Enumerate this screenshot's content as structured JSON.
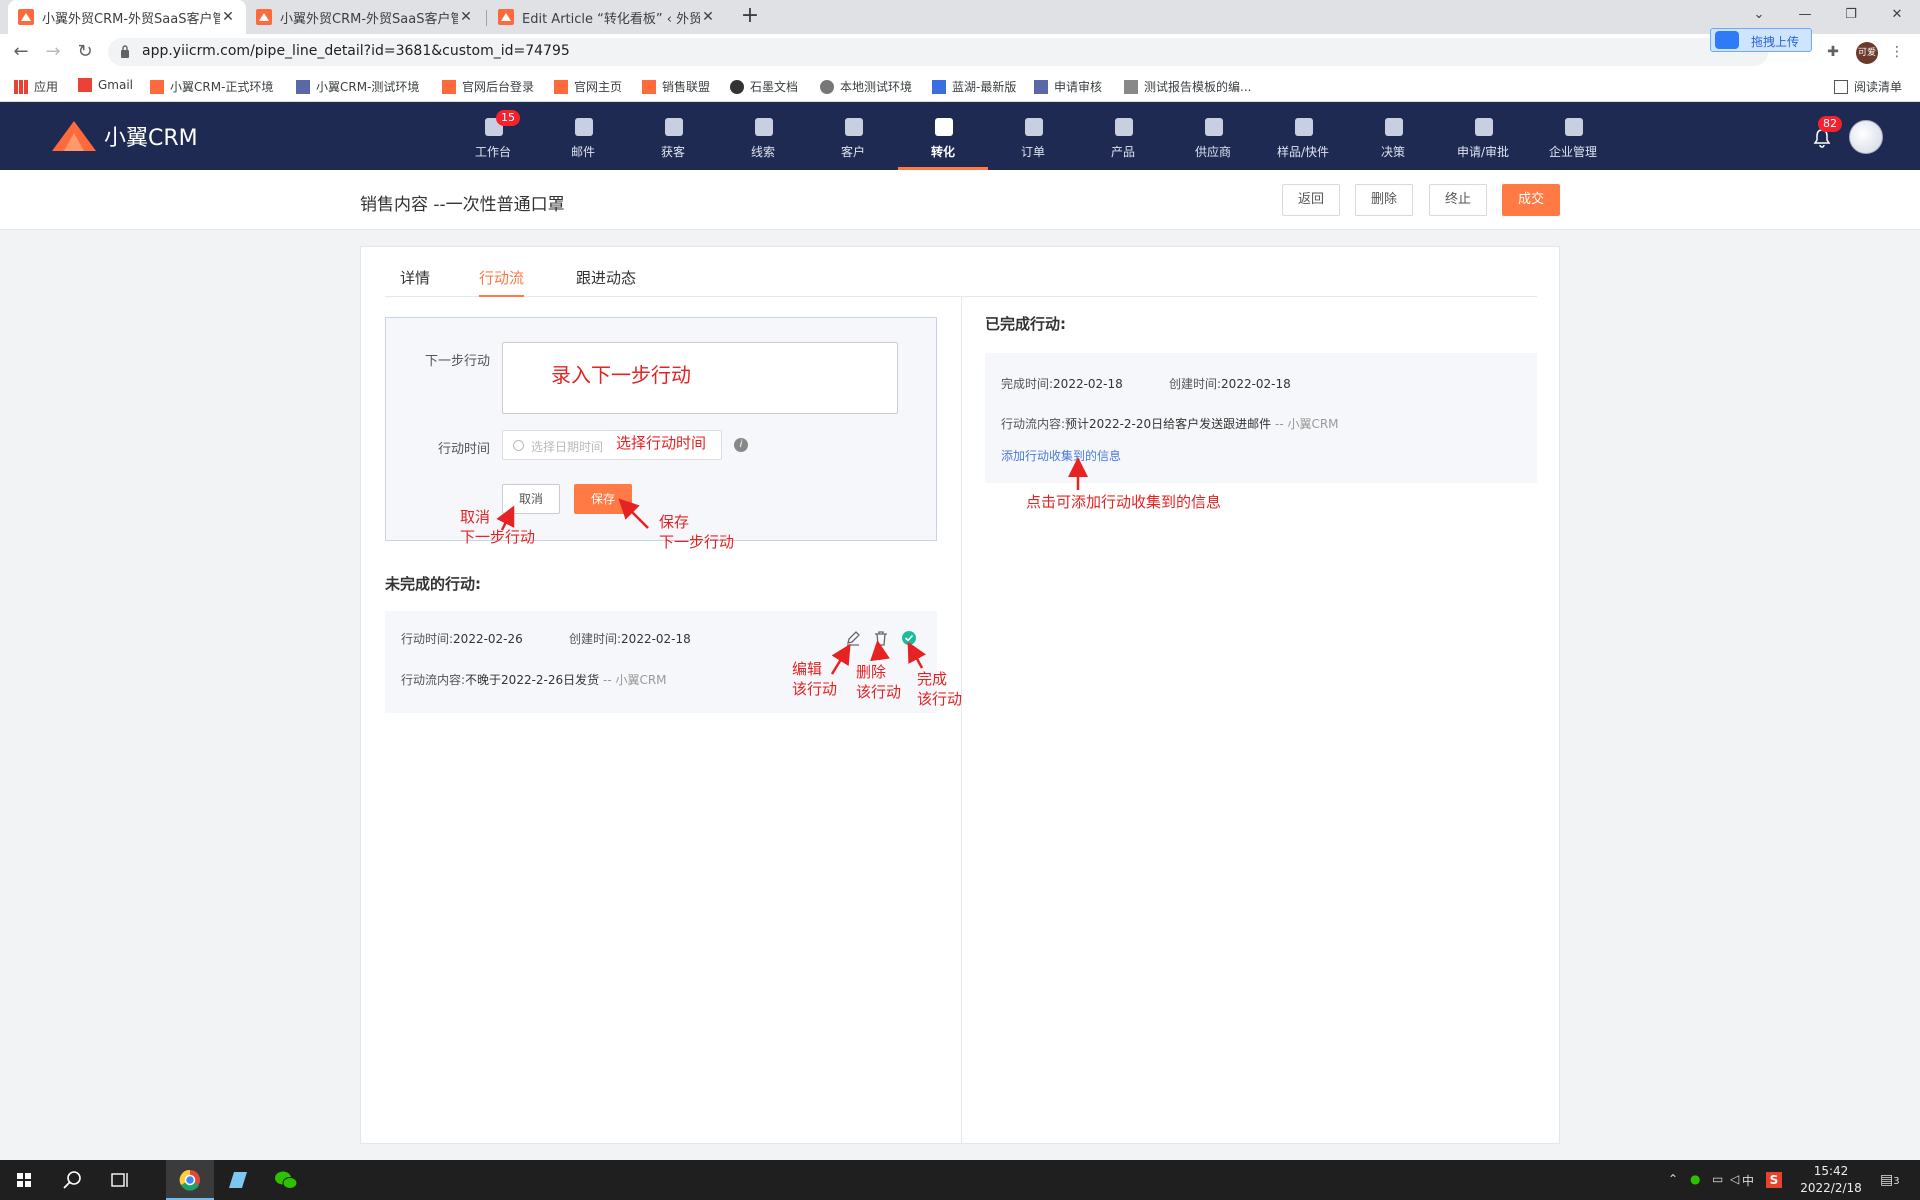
{
  "browser": {
    "tabs": [
      {
        "title": "小翼外贸CRM-外贸SaaS客户管理",
        "active": true
      },
      {
        "title": "小翼外贸CRM-外贸SaaS客户管理",
        "active": false
      },
      {
        "title": "Edit Article “转化看板” ‹ 外贸CR",
        "active": false
      }
    ],
    "url": "app.yiicrm.com/pipe_line_detail?id=3681&custom_id=74795",
    "upload_btn": "拖拽上传",
    "profile": "可爱",
    "bookmarks": [
      "应用",
      "Gmail",
      "小翼CRM-正式环境",
      "小翼CRM-测试环境",
      "官网后台登录",
      "官网主页",
      "销售联盟",
      "石墨文档",
      "本地测试环境",
      "蓝湖-最新版",
      "申请审核",
      "测试报告模板的编..."
    ],
    "reading_list": "阅读清单"
  },
  "app": {
    "logo": "小翼CRM",
    "nav": [
      {
        "label": "工作台",
        "icon": "workbench-icon",
        "badge": "15"
      },
      {
        "label": "邮件",
        "icon": "mail-icon"
      },
      {
        "label": "获客",
        "icon": "acquire-icon"
      },
      {
        "label": "线索",
        "icon": "leads-icon"
      },
      {
        "label": "客户",
        "icon": "customer-icon"
      },
      {
        "label": "转化",
        "icon": "funnel-icon",
        "active": true
      },
      {
        "label": "订单",
        "icon": "order-icon"
      },
      {
        "label": "产品",
        "icon": "product-icon"
      },
      {
        "label": "供应商",
        "icon": "supplier-icon"
      },
      {
        "label": "样品/快件",
        "icon": "sample-icon"
      },
      {
        "label": "决策",
        "icon": "decision-icon"
      },
      {
        "label": "申请/审批",
        "icon": "approval-icon"
      },
      {
        "label": "企业管理",
        "icon": "company-icon"
      }
    ],
    "bell_badge": "82"
  },
  "page": {
    "title": "销售内容 --一次性普通口罩",
    "buttons": {
      "back": "返回",
      "delete": "删除",
      "terminate": "终止",
      "deal": "成交"
    },
    "tabs": [
      "详情",
      "行动流",
      "跟进动态"
    ],
    "active_tab": "行动流"
  },
  "form": {
    "next_label": "下一步行动",
    "time_label": "行动时间",
    "date_placeholder": "选择日期时间",
    "cancel": "取消",
    "save": "保存"
  },
  "pending": {
    "heading": "未完成的行动:",
    "items": [
      {
        "time_label": "行动时间:",
        "time": "2022-02-26",
        "created_label": "创建时间:",
        "created": "2022-02-18",
        "content_label": "行动流内容:",
        "content": "不晚于2022-2-26日发货",
        "source": "-- 小翼CRM"
      }
    ]
  },
  "done": {
    "heading": "已完成行动:",
    "items": [
      {
        "time_label": "完成时间:",
        "time": "2022-02-18",
        "created_label": "创建时间:",
        "created": "2022-02-18",
        "content_label": "行动流内容:",
        "content": "预计2022-2-20日给客户发送跟进邮件",
        "source": "-- 小翼CRM",
        "link": "添加行动收集到的信息"
      }
    ]
  },
  "annotations": {
    "enter_next": "录入下一步行动",
    "choose_time": "选择行动时间",
    "cancel_1": "取消",
    "cancel_2": "下一步行动",
    "save_1": "保存",
    "save_2": "下一步行动",
    "edit_1": "编辑",
    "edit_2": "该行动",
    "del_1": "删除",
    "del_2": "该行动",
    "done_1": "完成",
    "done_2": "该行动",
    "add_info": "点击可添加行动收集到的信息"
  },
  "taskbar": {
    "ime": "中",
    "time": "15:42",
    "date": "2022/2/18",
    "notif": "3"
  },
  "colors": {
    "accent": "#ff7a45",
    "header": "#1e2a52",
    "annotation": "#e62222",
    "link": "#4a7bd8"
  }
}
